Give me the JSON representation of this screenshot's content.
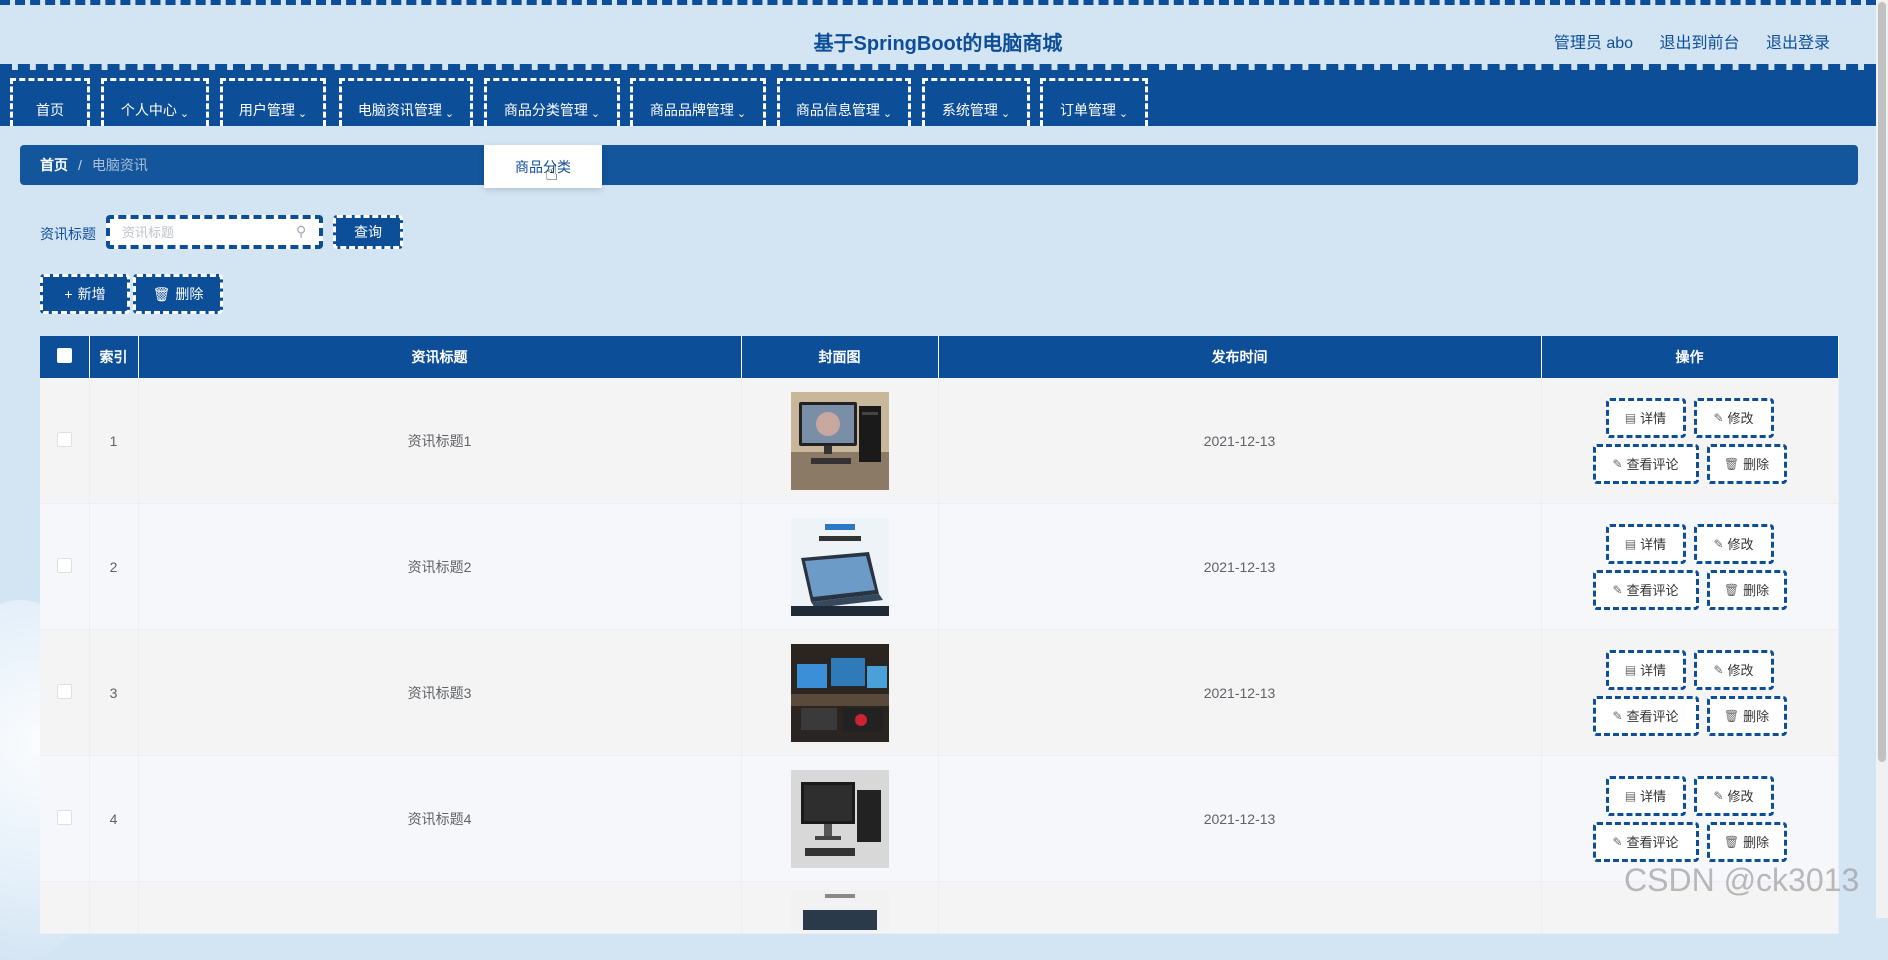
{
  "header": {
    "title": "基于SpringBoot的电脑商城",
    "user_label": "管理员 abo",
    "exit_front": "退出到前台",
    "logout": "退出登录"
  },
  "nav": {
    "items": [
      {
        "label": "首页",
        "has_menu": false
      },
      {
        "label": "个人中心",
        "has_menu": true
      },
      {
        "label": "用户管理",
        "has_menu": true
      },
      {
        "label": "电脑资讯管理",
        "has_menu": true
      },
      {
        "label": "商品分类管理",
        "has_menu": true
      },
      {
        "label": "商品品牌管理",
        "has_menu": true
      },
      {
        "label": "商品信息管理",
        "has_menu": true
      },
      {
        "label": "系统管理",
        "has_menu": true
      },
      {
        "label": "订单管理",
        "has_menu": true
      }
    ],
    "open_dropdown_item": "商品分类"
  },
  "breadcrumb": {
    "home": "首页",
    "separator": "/",
    "current": "电脑资讯"
  },
  "search": {
    "label": "资讯标题",
    "placeholder": "资讯标题",
    "query_button": "查询"
  },
  "actions": {
    "add": "新增",
    "delete": "删除"
  },
  "table": {
    "columns": [
      "索引",
      "资讯标题",
      "封面图",
      "发布时间",
      "操作"
    ],
    "rows": [
      {
        "index": "1",
        "title": "资讯标题1",
        "cover": "desktop-pc-photo",
        "date": "2021-12-13"
      },
      {
        "index": "2",
        "title": "资讯标题2",
        "cover": "surface-tablet-ad",
        "date": "2021-12-13"
      },
      {
        "index": "3",
        "title": "资讯标题3",
        "cover": "gaming-setup-photo",
        "date": "2021-12-13"
      },
      {
        "index": "4",
        "title": "资讯标题4",
        "cover": "office-pc-photo",
        "date": "2021-12-13"
      }
    ],
    "row_actions": {
      "detail": "详情",
      "edit": "修改",
      "comments": "查看评论",
      "delete": "删除"
    }
  },
  "watermark": "CSDN @ck3013",
  "colors": {
    "primary": "#0d4e98",
    "background": "#d3e4f3",
    "breadcrumb_bg": "#13569c"
  }
}
